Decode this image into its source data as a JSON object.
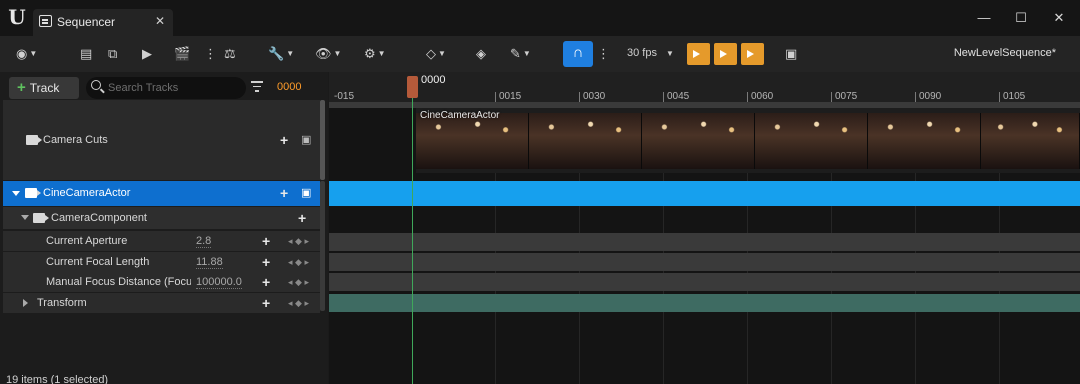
{
  "window": {
    "tab_title": "Sequencer",
    "close_glyph": "✕",
    "minimize_glyph": "—",
    "maximize_glyph": "☐",
    "window_close_glyph": "✕"
  },
  "toolbar": {
    "fps_label": "30 fps",
    "sequence_name": "NewLevelSequence*"
  },
  "tracks_panel": {
    "add_track_label": "Track",
    "search_placeholder": "Search Tracks",
    "current_frame": "0000",
    "status": "19 items (1 selected)"
  },
  "tracks": {
    "camera_cuts": {
      "label": "Camera Cuts"
    },
    "cine_actor": {
      "label": "CineCameraActor"
    },
    "camera_component": {
      "label": "CameraComponent"
    },
    "properties": [
      {
        "label": "Current Aperture",
        "value": "2.8"
      },
      {
        "label": "Current Focal Length",
        "value": "11.88"
      },
      {
        "label": "Manual Focus Distance (Focu",
        "value": "100000.0"
      },
      {
        "label": "Transform",
        "value": ""
      }
    ]
  },
  "timeline": {
    "playhead_label": "0000",
    "ticks": [
      "-015",
      "0015",
      "0030",
      "0045",
      "0060",
      "0075",
      "0090",
      "0105"
    ],
    "clip_label": "CineCameraActor"
  }
}
